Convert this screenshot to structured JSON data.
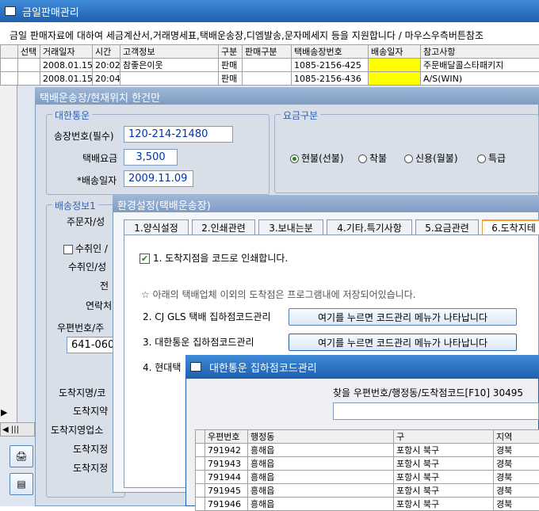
{
  "main_window": {
    "title": "금일판매관리",
    "info_text": "금일 판매자료에 대하여 세금계산서,거래명세표,택배운송장,디엠발송,문자메세지 등을 지원합니다 / 마우스우측버튼참조",
    "columns": [
      "선택",
      "거래일자",
      "시간",
      "고객정보",
      "구분",
      "판매구분",
      "택배송장번호",
      "배송일자",
      "참고사항"
    ],
    "rows": [
      {
        "date": "2008.01.15",
        "time": "20:02",
        "customer": "참좋은이웃",
        "type": "판매",
        "sale_type": "",
        "tracking": "1085-2156-425",
        "ship_date": "",
        "note": "주문배달콜스타패키지"
      },
      {
        "date": "2008.01.15",
        "time": "20:04",
        "customer": "",
        "type": "판매",
        "sale_type": "",
        "tracking": "1085-2156-436",
        "ship_date": "",
        "note": "A/S(WIN)"
      }
    ]
  },
  "waybill_window": {
    "title": "택배운송장/현재위치 한건만",
    "carrier_section": "대한통운",
    "invoice_label": "송장번호(필수)",
    "invoice_value": "120-214-21480",
    "fee_label": "택배요금",
    "fee_value": "3,500",
    "ship_date_label": "*배송일자",
    "ship_date_value": "2009.11.09",
    "fee_type_section": "요금구분",
    "fee_types": [
      {
        "label": "현불(선불)",
        "selected": true
      },
      {
        "label": "착불",
        "selected": false
      },
      {
        "label": "신용(월불)",
        "selected": false
      },
      {
        "label": "특급",
        "selected": false
      }
    ],
    "ship_info_section": "배송정보1",
    "field_labels": [
      "주문자/성",
      "수취인 /",
      "수취인/성",
      "전",
      "연락처",
      "우편번호/주",
      "도착지명/코",
      "도착지약",
      "도착지영업소",
      "도착지정",
      "도착지정"
    ],
    "postal_value": "641-060"
  },
  "settings_window": {
    "title": "환경설정(택배운송장)",
    "tabs": [
      "1.양식설정",
      "2.인쇄관련",
      "3.보내는분",
      "4.기타.특기사항",
      "5.요금관련",
      "6.도착지테"
    ],
    "print_code_label": "1. 도착지점을 코드로 인쇄합니다.",
    "print_code_checked": true,
    "note": "☆ 아래의 택배업체 이외의 도착점은 프로그램내에 저장되어있습니다.",
    "items": [
      {
        "label": "2. CJ GLS 택배 집하점코드관리",
        "button": "여기를 누르면 코드관리 메뉴가 나타납니다"
      },
      {
        "label": "3. 대한통운 집하점코드관리",
        "button": "여기를 누르면 코드관리 메뉴가 나타납니다"
      },
      {
        "label": "4. 현대택",
        "button": ""
      }
    ]
  },
  "code_window": {
    "title": "대한통운 집하점코드관리",
    "search_label": "찾을 우편번호/행정동/도착점코드[F10] 30495",
    "columns": [
      "우편번호",
      "행정동",
      "구",
      "지역"
    ],
    "rows": [
      [
        "791942",
        "흥해읍",
        "포항시 북구",
        "경북"
      ],
      [
        "791943",
        "흥해읍",
        "포항시 북구",
        "경북"
      ],
      [
        "791944",
        "흥해읍",
        "포항시 북구",
        "경북"
      ],
      [
        "791945",
        "흥해읍",
        "포항시 북구",
        "경북"
      ],
      [
        "791946",
        "흥해읍",
        "포항시 북구",
        "경북"
      ]
    ]
  },
  "colors": {
    "title_bar": "#2a6fc0",
    "highlight": "#ffff00",
    "panel": "#d8dfe9",
    "input_text": "#0033aa"
  }
}
